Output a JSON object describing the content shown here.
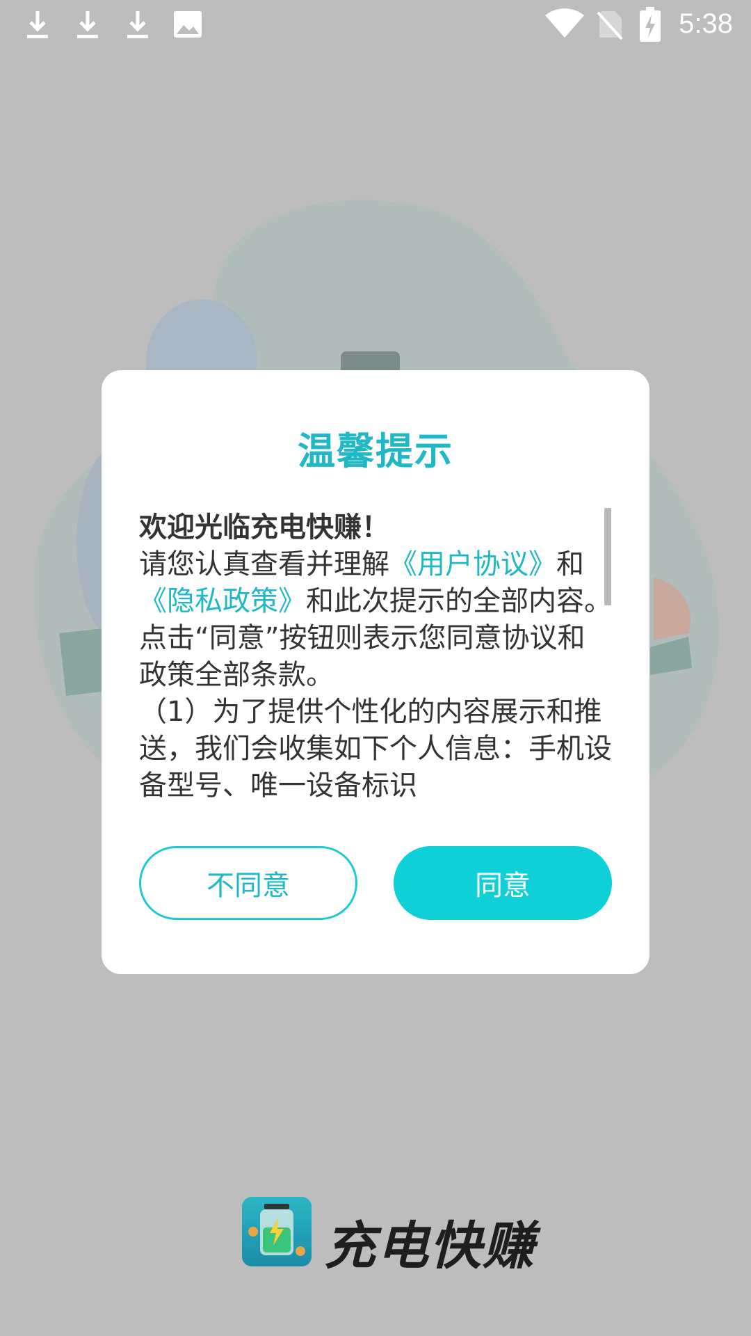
{
  "status_bar": {
    "time": "5:38",
    "icons": [
      "download-icon",
      "download-icon",
      "download-icon",
      "image-icon",
      "wifi-icon",
      "no-sim-icon",
      "battery-charging-icon"
    ]
  },
  "dialog": {
    "title": "温馨提示",
    "welcome": "欢迎光临充电快赚！",
    "p1_a": "请您认真查看并理解",
    "user_agreement_link": "《用户协议》",
    "p1_b": "和",
    "privacy_link": "《隐私政策》",
    "p1_c": "和此次提示的全部内容。点击“同意”按钮则表示您同意协议和政策全部条款。",
    "p2": "（1）为了提供个性化的内容展示和推送，我们会收集如下个人信息：手机设备型号、唯一设备标识",
    "disagree_label": "不同意",
    "agree_label": "同意"
  },
  "app": {
    "name": "充电快赚"
  },
  "colors": {
    "accent": "#1fb8c4",
    "agree_button": "#0fd0d6",
    "overlay": "#bdbdbd"
  }
}
